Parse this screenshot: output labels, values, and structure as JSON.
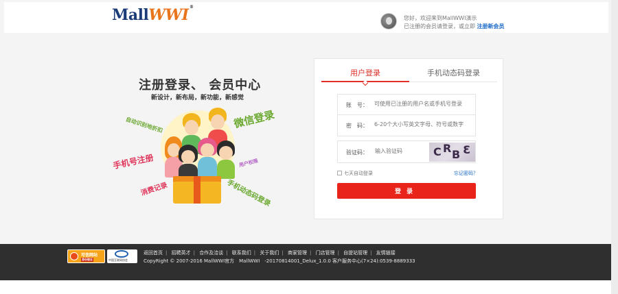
{
  "header": {
    "logo_left": "Mall",
    "logo_right": "WWI",
    "logo_mark": "®",
    "greeting": "您好，欢迎来到MallWWI演示",
    "login_prompt": "已注册的会员请登录，或立即",
    "register_link": "注册新会员"
  },
  "promo": {
    "title": "注册登录、 会员中心",
    "subtitle": "新设计，新布局，新功能，新感觉",
    "tag_wechat": "微信登录",
    "tag_auto": "自动识别地折扣",
    "tag_phone": "手机号注册",
    "tag_user": "用户权限",
    "tag_consume": "消费记录",
    "tag_dynamic": "手机动态码登录"
  },
  "login": {
    "tab_user": "用户登录",
    "tab_sms": "手机动态码登录",
    "account_label": "账　号：",
    "account_placeholder": "可使用已注册的用户名或手机号登录",
    "password_label": "密　码：",
    "password_placeholder": "6-20个大小写英文字母、符号或数字",
    "captcha_label": "验证码：",
    "captcha_placeholder": "输入验证码",
    "captcha_text_1": "C",
    "captcha_text_2": "R",
    "captcha_text_3": "B",
    "captcha_text_4": "3",
    "remember_label": "七天自动登录",
    "forgot_link": "忘记密码？",
    "submit_label": "登录"
  },
  "footer": {
    "badge_trust_title": "可信网站",
    "badge_trust_sub": "身份验证",
    "badge_cnnic": "中国互联网协会",
    "links": [
      "返回首页",
      "招聘英才",
      "合作及洽谈",
      "联系我们",
      "关于我们",
      "商家管理",
      "门店管理",
      "自提站管理",
      "友情链接"
    ],
    "copyright": "CopyRight © 2007-2016 MallWWI官方　MallWWI　-20170814001_Delux_1.0.0 客户服务中心(7×24):0539-8889333"
  },
  "colors": {
    "accent_red": "#e8241b",
    "link_blue": "#1b6ac9",
    "footer_bg": "#2f2f2f"
  }
}
